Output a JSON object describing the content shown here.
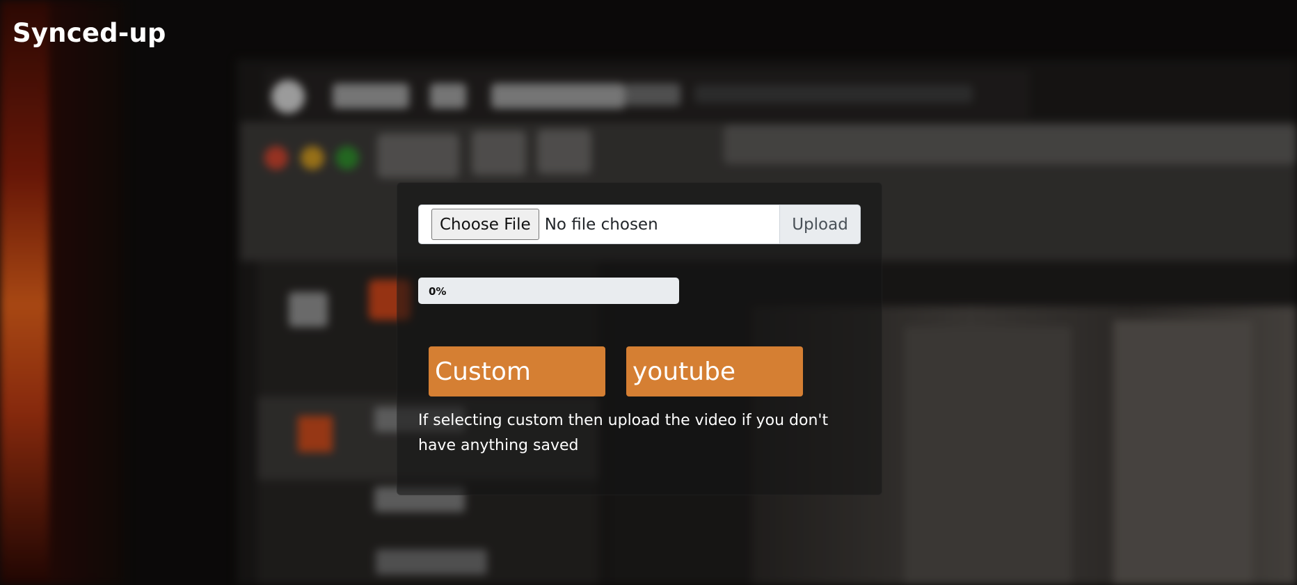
{
  "header": {
    "brand": "Synced-up"
  },
  "upload": {
    "choose_file_label": "Choose File",
    "file_status": "No file chosen",
    "upload_label": "Upload"
  },
  "progress": {
    "value": 0,
    "label": "0%"
  },
  "options": {
    "custom_label": "Custom",
    "youtube_label": "youtube"
  },
  "hint": {
    "text": "If selecting custom then upload the video if you don't have anything saved"
  },
  "colors": {
    "accent": "#d57f33",
    "progress_track": "#e9ecef",
    "text_light": "#ffffff"
  }
}
